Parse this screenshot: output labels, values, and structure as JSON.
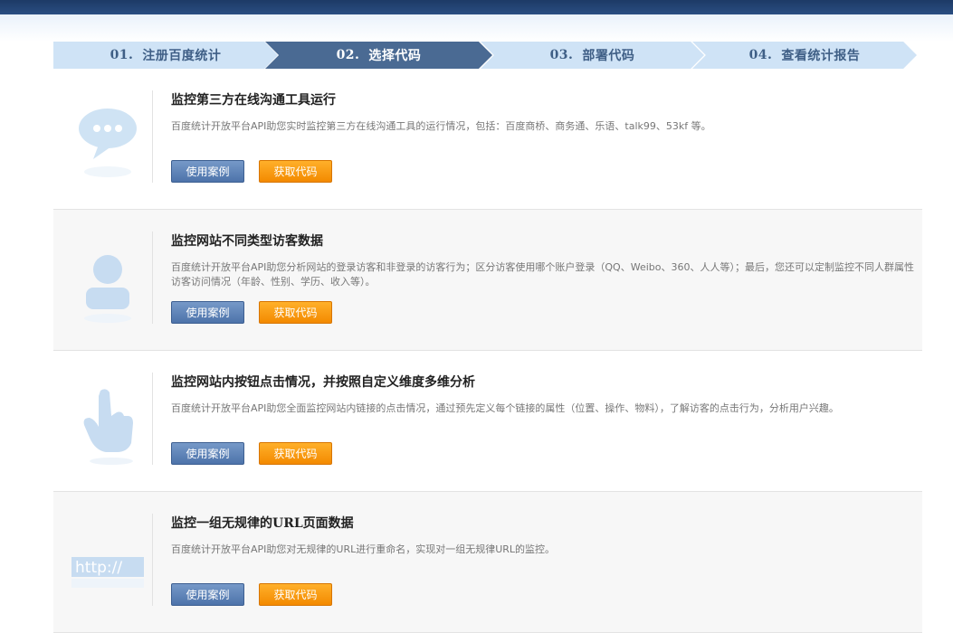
{
  "steps": [
    {
      "num": "01.",
      "label": "注册百度统计"
    },
    {
      "num": "02.",
      "label": "选择代码"
    },
    {
      "num": "03.",
      "label": "部署代码"
    },
    {
      "num": "04.",
      "label": "查看统计报告"
    }
  ],
  "active_step": 2,
  "sections": [
    {
      "title": "监控第三方在线沟通工具运行",
      "desc": "百度统计开放平台API助您实时监控第三方在线沟通工具的运行情况，包括：百度商桥、商务通、乐语、talk99、53kf 等。",
      "case_label": "使用案例",
      "code_label": "获取代码",
      "icon": "chat-bubble-icon"
    },
    {
      "title": "监控网站不同类型访客数据",
      "desc": "百度统计开放平台API助您分析网站的登录访客和非登录的访客行为；区分访客使用哪个账户登录（QQ、Weibo、360、人人等）；最后，您还可以定制监控不同人群属性访客访问情况（年龄、性别、学历、收入等）。",
      "case_label": "使用案例",
      "code_label": "获取代码",
      "icon": "user-icon"
    },
    {
      "title": "监控网站内按钮点击情况，并按照自定义维度多维分析",
      "desc": "百度统计开放平台API助您全面监控网站内链接的点击情况，通过预先定义每个链接的属性（位置、操作、物料），了解访客的点击行为，分析用户兴趣。",
      "case_label": "使用案例",
      "code_label": "获取代码",
      "icon": "pointer-hand-icon"
    },
    {
      "title": "监控一组无规律的URL页面数据",
      "desc": "百度统计开放平台API助您对无规律的URL进行重命名，实现对一组无规律URL的监控。",
      "case_label": "使用案例",
      "code_label": "获取代码",
      "icon": "http-url-icon",
      "icon_text": "http://"
    }
  ],
  "colors": {
    "top_bar": "#1d3a66",
    "step_active": "#4a6a93",
    "step_inactive": "#cfe3f6",
    "btn_case": "#4d73aa",
    "btn_code": "#f38a00"
  }
}
